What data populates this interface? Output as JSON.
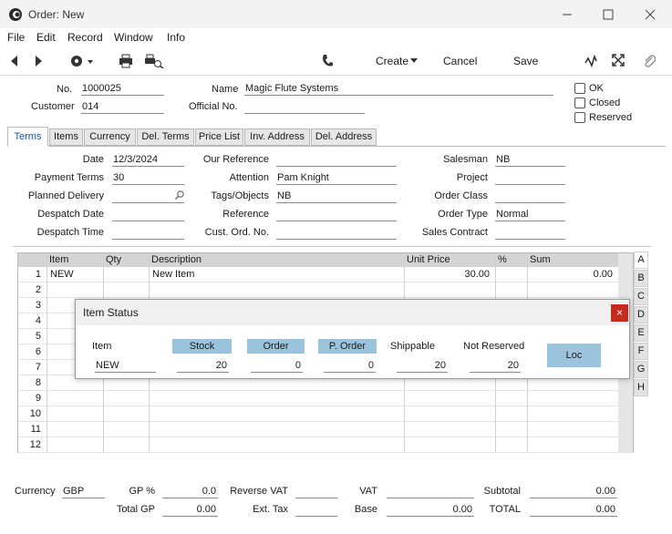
{
  "window": {
    "title": "Order: New"
  },
  "menu": [
    "File",
    "Edit",
    "Record",
    "Window",
    "Info"
  ],
  "toolbar": {
    "create": "Create",
    "cancel": "Cancel",
    "save": "Save"
  },
  "header": {
    "no_label": "No.",
    "no_value": "1000025",
    "customer_label": "Customer",
    "customer_value": "014",
    "name_label": "Name",
    "name_value": "Magic Flute Systems",
    "official_label": "Official No.",
    "official_value": "",
    "ok_label": "OK",
    "closed_label": "Closed",
    "reserved_label": "Reserved"
  },
  "tabs": [
    "Terms",
    "Items",
    "Currency",
    "Del. Terms",
    "Price List",
    "Inv. Address",
    "Del. Address"
  ],
  "terms": {
    "date_label": "Date",
    "date_value": "12/3/2024",
    "payment_label": "Payment Terms",
    "payment_value": "30",
    "planned_label": "Planned Delivery",
    "planned_value": "",
    "despatch_date_label": "Despatch Date",
    "despatch_date_value": "",
    "despatch_time_label": "Despatch Time",
    "despatch_time_value": "",
    "our_ref_label": "Our Reference",
    "our_ref_value": "",
    "attention_label": "Attention",
    "attention_value": "Pam Knight",
    "tags_label": "Tags/Objects",
    "tags_value": "NB",
    "reference_label": "Reference",
    "reference_value": "",
    "cust_ord_label": "Cust. Ord. No.",
    "cust_ord_value": "",
    "salesman_label": "Salesman",
    "salesman_value": "NB",
    "project_label": "Project",
    "project_value": "",
    "order_class_label": "Order Class",
    "order_class_value": "",
    "order_type_label": "Order Type",
    "order_type_value": "Normal",
    "sales_contract_label": "Sales Contract",
    "sales_contract_value": ""
  },
  "grid": {
    "headers": [
      "Item",
      "Qty",
      "Description",
      "Unit Price",
      "%",
      "Sum"
    ],
    "rows": [
      {
        "n": "1",
        "item": "NEW",
        "qty": "",
        "desc": "New Item",
        "price": "30.00",
        "pct": "",
        "sum": "0.00"
      },
      {
        "n": "2"
      },
      {
        "n": "3"
      },
      {
        "n": "4"
      },
      {
        "n": "5"
      },
      {
        "n": "6"
      },
      {
        "n": "7"
      },
      {
        "n": "8"
      },
      {
        "n": "9"
      },
      {
        "n": "10"
      },
      {
        "n": "11"
      },
      {
        "n": "12"
      }
    ],
    "side_tabs": [
      "A",
      "B",
      "C",
      "D",
      "E",
      "F",
      "G",
      "H"
    ]
  },
  "popup": {
    "title": "Item Status",
    "close": "×",
    "item_label": "Item",
    "item_value": "NEW",
    "stock_label": "Stock",
    "stock_value": "20",
    "order_label": "Order",
    "order_value": "0",
    "porder_label": "P. Order",
    "porder_value": "0",
    "shippable_label": "Shippable",
    "shippable_value": "20",
    "notres_label": "Not Reserved",
    "notres_value": "20",
    "loc_label": "Loc"
  },
  "footer": {
    "currency_label": "Currency",
    "currency_value": "GBP",
    "gp_label": "GP %",
    "gp_value": "0.0",
    "totalgp_label": "Total GP",
    "totalgp_value": "0.00",
    "revvat_label": "Reverse VAT",
    "revvat_value": "",
    "exttax_label": "Ext. Tax",
    "exttax_value": "",
    "vat_label": "VAT",
    "vat_value": "",
    "base_label": "Base",
    "base_value": "0.00",
    "subtotal_label": "Subtotal",
    "subtotal_value": "0.00",
    "total_label": "TOTAL",
    "total_value": "0.00"
  },
  "colors": {
    "accent_button": "#9cc3dc",
    "close_red": "#c42b1c",
    "tab_active_text": "#0b57a4"
  }
}
